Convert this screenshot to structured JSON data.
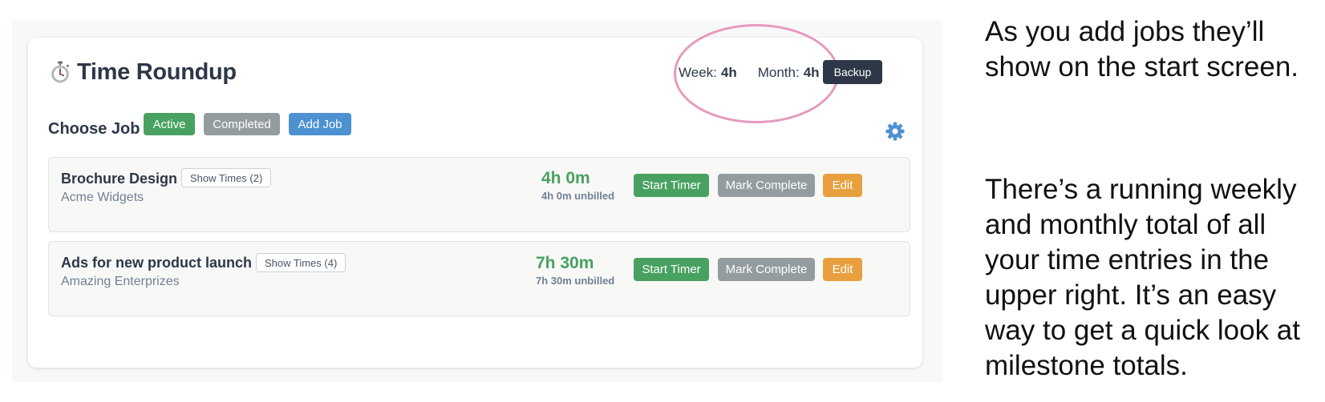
{
  "app": {
    "title": "Time Roundup",
    "backup_label": "Backup"
  },
  "totals": {
    "week_label": "Week:",
    "week_value": "4h",
    "month_label": "Month:",
    "month_value": "4h"
  },
  "jobs_bar": {
    "title": "Choose Job",
    "filters": [
      {
        "label": "Active",
        "color": "#48a160"
      },
      {
        "label": "Completed",
        "color": "#939c9f"
      }
    ],
    "add_label": "Add Job",
    "settings_icon": "gear-icon"
  },
  "jobs": [
    {
      "name": "Brochure Design",
      "client": "Acme Widgets",
      "show_times_label": "Show Times (2)",
      "total": "4h 0m",
      "unbilled": "4h 0m unbilled",
      "start_label": "Start Timer",
      "complete_label": "Mark Complete",
      "edit_label": "Edit"
    },
    {
      "name": "Ads for new product launch",
      "client": "Amazing Enterprizes",
      "show_times_label": "Show Times (4)",
      "total": "7h 30m",
      "unbilled": "7h 30m unbilled",
      "start_label": "Start Timer",
      "complete_label": "Mark Complete",
      "edit_label": "Edit"
    }
  ],
  "captions": {
    "top": [
      "As you add jobs they’ll",
      "show on the start screen."
    ],
    "bottom": [
      "There’s a running weekly",
      "and monthly total of all",
      "your time entries in the",
      "upper right. It’s an easy",
      "way to get a quick look at",
      "milestone totals."
    ]
  },
  "colors": {
    "accent_green": "#48a160",
    "accent_blue": "#4e91d0",
    "accent_orange": "#e8a03e",
    "dark": "#2d3748",
    "highlight": "#e59abd"
  }
}
